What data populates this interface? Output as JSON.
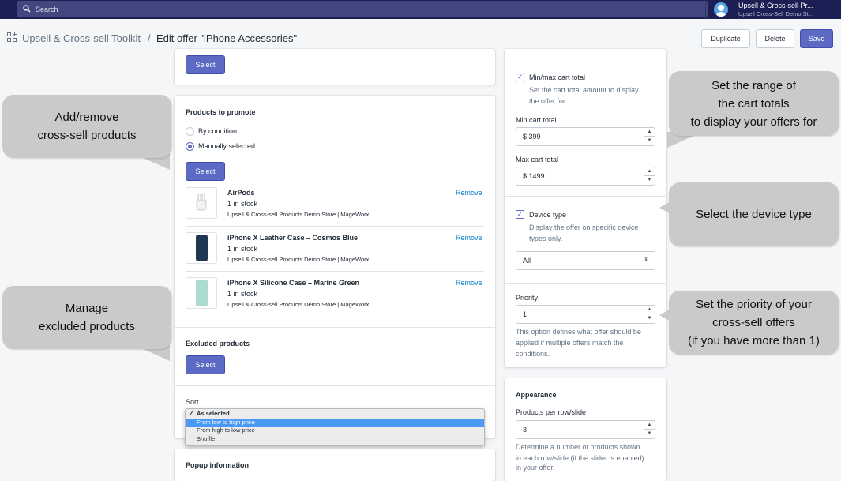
{
  "topbar": {
    "search_placeholder": "Search",
    "account_name": "Upsell & Cross-sell Pr...",
    "account_store": "Upsell Cross-Sell Demo St..."
  },
  "header": {
    "app_name": "Upsell & Cross-sell Toolkit",
    "separator": "/",
    "page_title": "Edit offer \"iPhone Accessories\"",
    "duplicate": "Duplicate",
    "delete": "Delete",
    "save": "Save"
  },
  "left": {
    "top_select": "Select",
    "promote": {
      "title": "Products to promote",
      "options": [
        "By condition",
        "Manually selected"
      ],
      "selected": "Manually selected",
      "select": "Select",
      "products": [
        {
          "name": "AirPods",
          "stock": "1 in stock",
          "vendor": "Upsell & Cross-sell Products Demo Store | MageWorx",
          "remove": "Remove"
        },
        {
          "name": "iPhone X Leather Case – Cosmos Blue",
          "stock": "1 in stock",
          "vendor": "Upsell & Cross-sell Products Demo Store | MageWorx",
          "remove": "Remove"
        },
        {
          "name": "iPhone X Silicone Case – Marine Green",
          "stock": "1 in stock",
          "vendor": "Upsell & Cross-sell Products Demo Store | MageWorx",
          "remove": "Remove"
        }
      ]
    },
    "excluded": {
      "title": "Excluded products",
      "select": "Select"
    },
    "sort": {
      "label": "Sort",
      "checkmark": "✓",
      "options": [
        "As selected",
        "From low to high price",
        "From high to low price",
        "Shuffle"
      ],
      "selected": "As selected",
      "highlighted": "From low to high price"
    },
    "popup": {
      "title": "Popup information"
    }
  },
  "right": {
    "cart": {
      "checkbox_label": "Min/max cart total",
      "checked": true,
      "help": [
        "Set the cart total amount to display",
        "the offer for."
      ],
      "min_label": "Min cart total",
      "min_value": "$  399",
      "max_label": "Max cart total",
      "max_value": "$  1499"
    },
    "device": {
      "checkbox_label": "Device type",
      "checked": true,
      "help": [
        "Display the offer on specific device",
        "types only."
      ],
      "value": "All"
    },
    "priority": {
      "label": "Priority",
      "value": "1",
      "help": [
        "This option defines what offer should be",
        "applied if multiple offers match the",
        "conditions."
      ]
    },
    "appearance": {
      "title": "Appearance",
      "label": "Products per row/slide",
      "value": "3",
      "help": [
        "Determine a number of products shown",
        "in each row/slide (if the slider is enabled)",
        "in your offer."
      ]
    }
  },
  "callouts": {
    "add_remove": [
      "Add/remove",
      "cross-sell products"
    ],
    "excluded": [
      "Manage",
      "excluded products"
    ],
    "range": [
      "Set the range of",
      "the cart totals",
      "to display your offers for"
    ],
    "device": [
      "Select the device type"
    ],
    "priority": [
      "Set the priority of your",
      "cross-sell offers",
      "(if you have more than 1)"
    ]
  },
  "colors": {
    "topbar": "#1c1f54",
    "primary": "#5c6ac4",
    "link": "#007ace",
    "callout": "#c9cacc",
    "highlight": "#4a9af5"
  }
}
